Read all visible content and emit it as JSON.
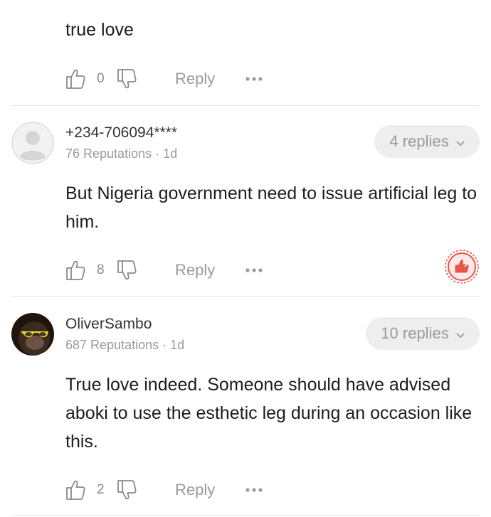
{
  "comments": [
    {
      "text": "true love",
      "likes": "0",
      "reply_label": "Reply"
    },
    {
      "author": "+234-706094****",
      "reputations": "76 Reputations",
      "time": "1d",
      "replies": "4 replies",
      "text": "But Nigeria government need to issue artificial leg to him.",
      "likes": "8",
      "reply_label": "Reply",
      "badge_icon": "thumbs-up-stamp-icon",
      "avatar": "default-avatar-icon"
    },
    {
      "author": "OliverSambo",
      "reputations": "687 Reputations",
      "time": "1d",
      "replies": "10 replies",
      "text": "True love indeed. Someone should have advised aboki to use the esthetic leg during an occasion like this.",
      "likes": "2",
      "reply_label": "Reply",
      "avatar": "chimp-sunglasses-avatar"
    }
  ],
  "meta_separator": "·",
  "colors": {
    "text": "#1c1c1c",
    "muted": "#9a9a9a",
    "pill_bg": "#eeeeee",
    "badge_red": "#e8554a",
    "divider": "#e6e6e6"
  }
}
